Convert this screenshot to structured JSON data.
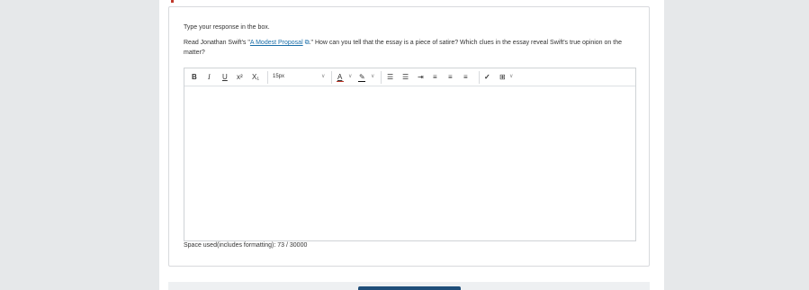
{
  "question": {
    "instructions": "Type your response in the box.",
    "prompt_before": "Read Jonathan Swift's \"",
    "link_text": "A Modest Proposal",
    "prompt_after": ".\" How can you tell that the essay is a piece of satire? Which clues in the essay reveal Swift's true opinion on the matter?"
  },
  "toolbar": {
    "bold": "B",
    "italic": "I",
    "underline": "U",
    "superscript": "x²",
    "subscript": "X₁",
    "font_size": "15px",
    "colors": {
      "font": "#c0392b",
      "highlight": "#111111"
    }
  },
  "editor": {
    "value": ""
  },
  "counter": "Space used(includes formatting): 73 / 30000"
}
